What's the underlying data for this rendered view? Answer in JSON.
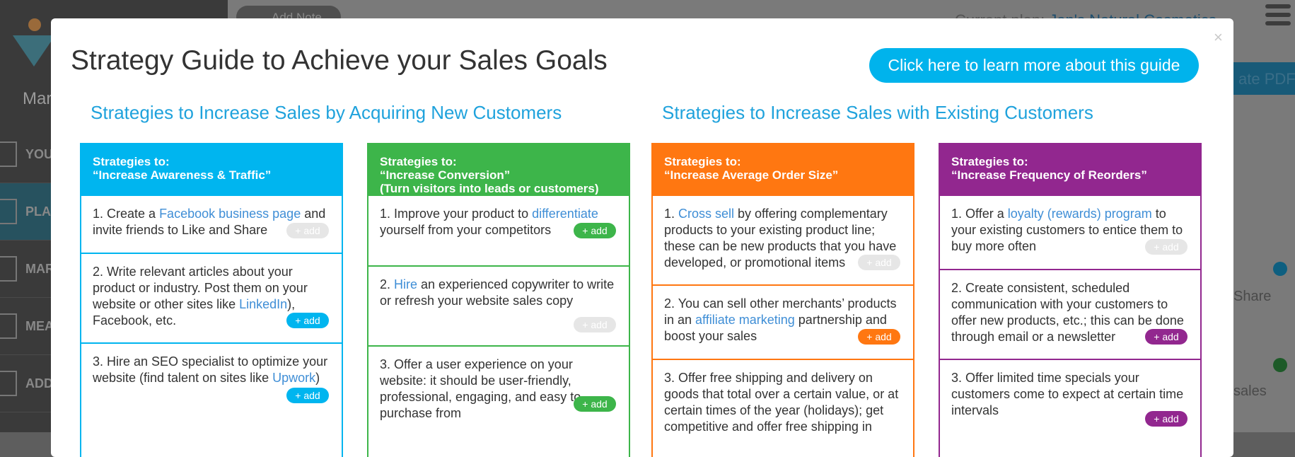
{
  "background": {
    "brand_fragment": "Mar",
    "add_note": "Add Note",
    "plan_prefix": "Current plan:",
    "plan_name": "Jan's Natural Cosmetics",
    "generate_pdf": "ate PDF",
    "nav": [
      "YOU",
      "PLA",
      "MAR",
      "MEA",
      "ADD"
    ],
    "share_fragment": "Share",
    "sales_fragment": "sales"
  },
  "modal": {
    "title": "Strategy Guide to Achieve your Sales Goals",
    "learn_more": "Click here to learn more about this guide",
    "close": "×",
    "section_new": "Strategies to Increase Sales by Acquiring New Customers",
    "section_existing": "Strategies to Increase Sales with Existing Customers"
  },
  "columns": [
    {
      "color": "#00b5ef",
      "head": [
        "Strategies to:",
        "“Increase Awareness & Traffic”"
      ],
      "items": [
        {
          "pre": "1. Create a ",
          "link": "Facebook business page",
          "post": " and invite friends to Like and Share",
          "add": "+ add",
          "active": false
        },
        {
          "pre": "2. Write relevant articles about your product or industry. Post them on your website or other sites like ",
          "link": "LinkedIn",
          "post": "), Facebook, etc.",
          "add": "+ add",
          "active": true
        },
        {
          "pre": "3. Hire an SEO specialist to optimize your website (find talent on sites like ",
          "link": "Upwork",
          "post": ")",
          "add": "+ add",
          "active": true
        }
      ]
    },
    {
      "color": "#3db54a",
      "head": [
        "Strategies to:",
        "“Increase Conversion”",
        "(Turn visitors into leads or customers)"
      ],
      "items": [
        {
          "pre": "1. Improve your product to ",
          "link": "differentiate",
          "post": " yourself from your competitors",
          "add": "+ add",
          "active": true
        },
        {
          "pre": "2. ",
          "link": "Hire",
          "post": " an experienced copywriter to write or refresh your website sales copy",
          "add": "+ add",
          "active": false
        },
        {
          "pre": "3. Offer a user experience on your website: it should be user-friendly, professional, engaging, and easy to purchase from",
          "link": "",
          "post": "",
          "add": "+ add",
          "active": true
        }
      ]
    },
    {
      "color": "#ff7711",
      "head": [
        "Strategies to:",
        "“Increase Average Order Size”"
      ],
      "items": [
        {
          "pre": "1. ",
          "link": "Cross sell",
          "post": " by offering complementary products to your existing product line; these can be new products that you have developed, or promotional items",
          "add": "+ add",
          "active": false
        },
        {
          "pre": "2. You can sell other merchants’ products in an ",
          "link": "affiliate marketing",
          "post": " partnership and boost your sales",
          "add": "+ add",
          "active": true
        },
        {
          "pre": "3. Offer free shipping and delivery on goods that total over a certain value, or at certain times of the year (holidays); get competitive and offer free shipping in",
          "link": "",
          "post": "",
          "add": "",
          "active": true
        }
      ]
    },
    {
      "color": "#92278f",
      "head": [
        "Strategies to:",
        "“Increase Frequency of Reorders”"
      ],
      "items": [
        {
          "pre": "1. Offer a ",
          "link": "loyalty (rewards) program",
          "post": " to your existing customers to entice them to buy more often",
          "add": "+ add",
          "active": false
        },
        {
          "pre": "2. Create consistent, scheduled communication with your customers to offer new products, etc.; this can be done through email or a newsletter",
          "link": "",
          "post": "",
          "add": "+ add",
          "active": true
        },
        {
          "pre": "3. Offer limited time specials your customers come to expect at certain time intervals",
          "link": "",
          "post": "",
          "add": "+ add",
          "active": true
        }
      ]
    }
  ]
}
